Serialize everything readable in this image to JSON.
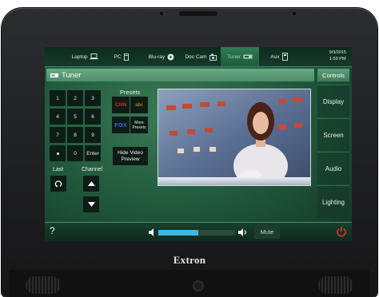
{
  "device": {
    "brand": "Extron"
  },
  "sources": [
    {
      "label": "Laptop",
      "icon": "laptop-icon",
      "active": false
    },
    {
      "label": "PC",
      "icon": "pc-tower-icon",
      "active": false
    },
    {
      "label": "Blu-ray",
      "icon": "disc-icon",
      "active": false
    },
    {
      "label": "Doc Cam",
      "icon": "document-camera-icon",
      "active": false
    },
    {
      "label": "Tuner",
      "icon": "tuner-icon",
      "active": true
    },
    {
      "label": "Aux",
      "icon": "aux-device-icon",
      "active": false
    }
  ],
  "datetime": {
    "date": "9/3/2015",
    "time": "1:59 PM"
  },
  "page": {
    "title": "Tuner",
    "controls_label": "Controls"
  },
  "keypad": {
    "keys": [
      "1",
      "2",
      "3",
      "4",
      "5",
      "6",
      "7",
      "8",
      "9",
      "",
      "0",
      "Enter"
    ],
    "last_label": "Last",
    "channel_label": "Channel"
  },
  "presets": {
    "heading": "Presets",
    "channels": [
      {
        "logo": "CNN",
        "color": "#d22a20"
      },
      {
        "logo": "abc",
        "color": "#d4a017"
      },
      {
        "logo": "FOX",
        "color": "#2a6fd0"
      }
    ],
    "more_label_line1": "More",
    "more_label_line2": "Presets"
  },
  "hide_video": {
    "line1": "Hide Video",
    "line2": "Preview"
  },
  "side_menu": [
    "Display",
    "Screen",
    "Audio",
    "Lighting"
  ],
  "bottom": {
    "help_label": "?",
    "mute_label": "Mute",
    "volume_level": 0.52
  },
  "colors": {
    "accent_green": "#3e8a5f",
    "volume_blue": "#3db8e2",
    "power_red": "#e0331f"
  }
}
